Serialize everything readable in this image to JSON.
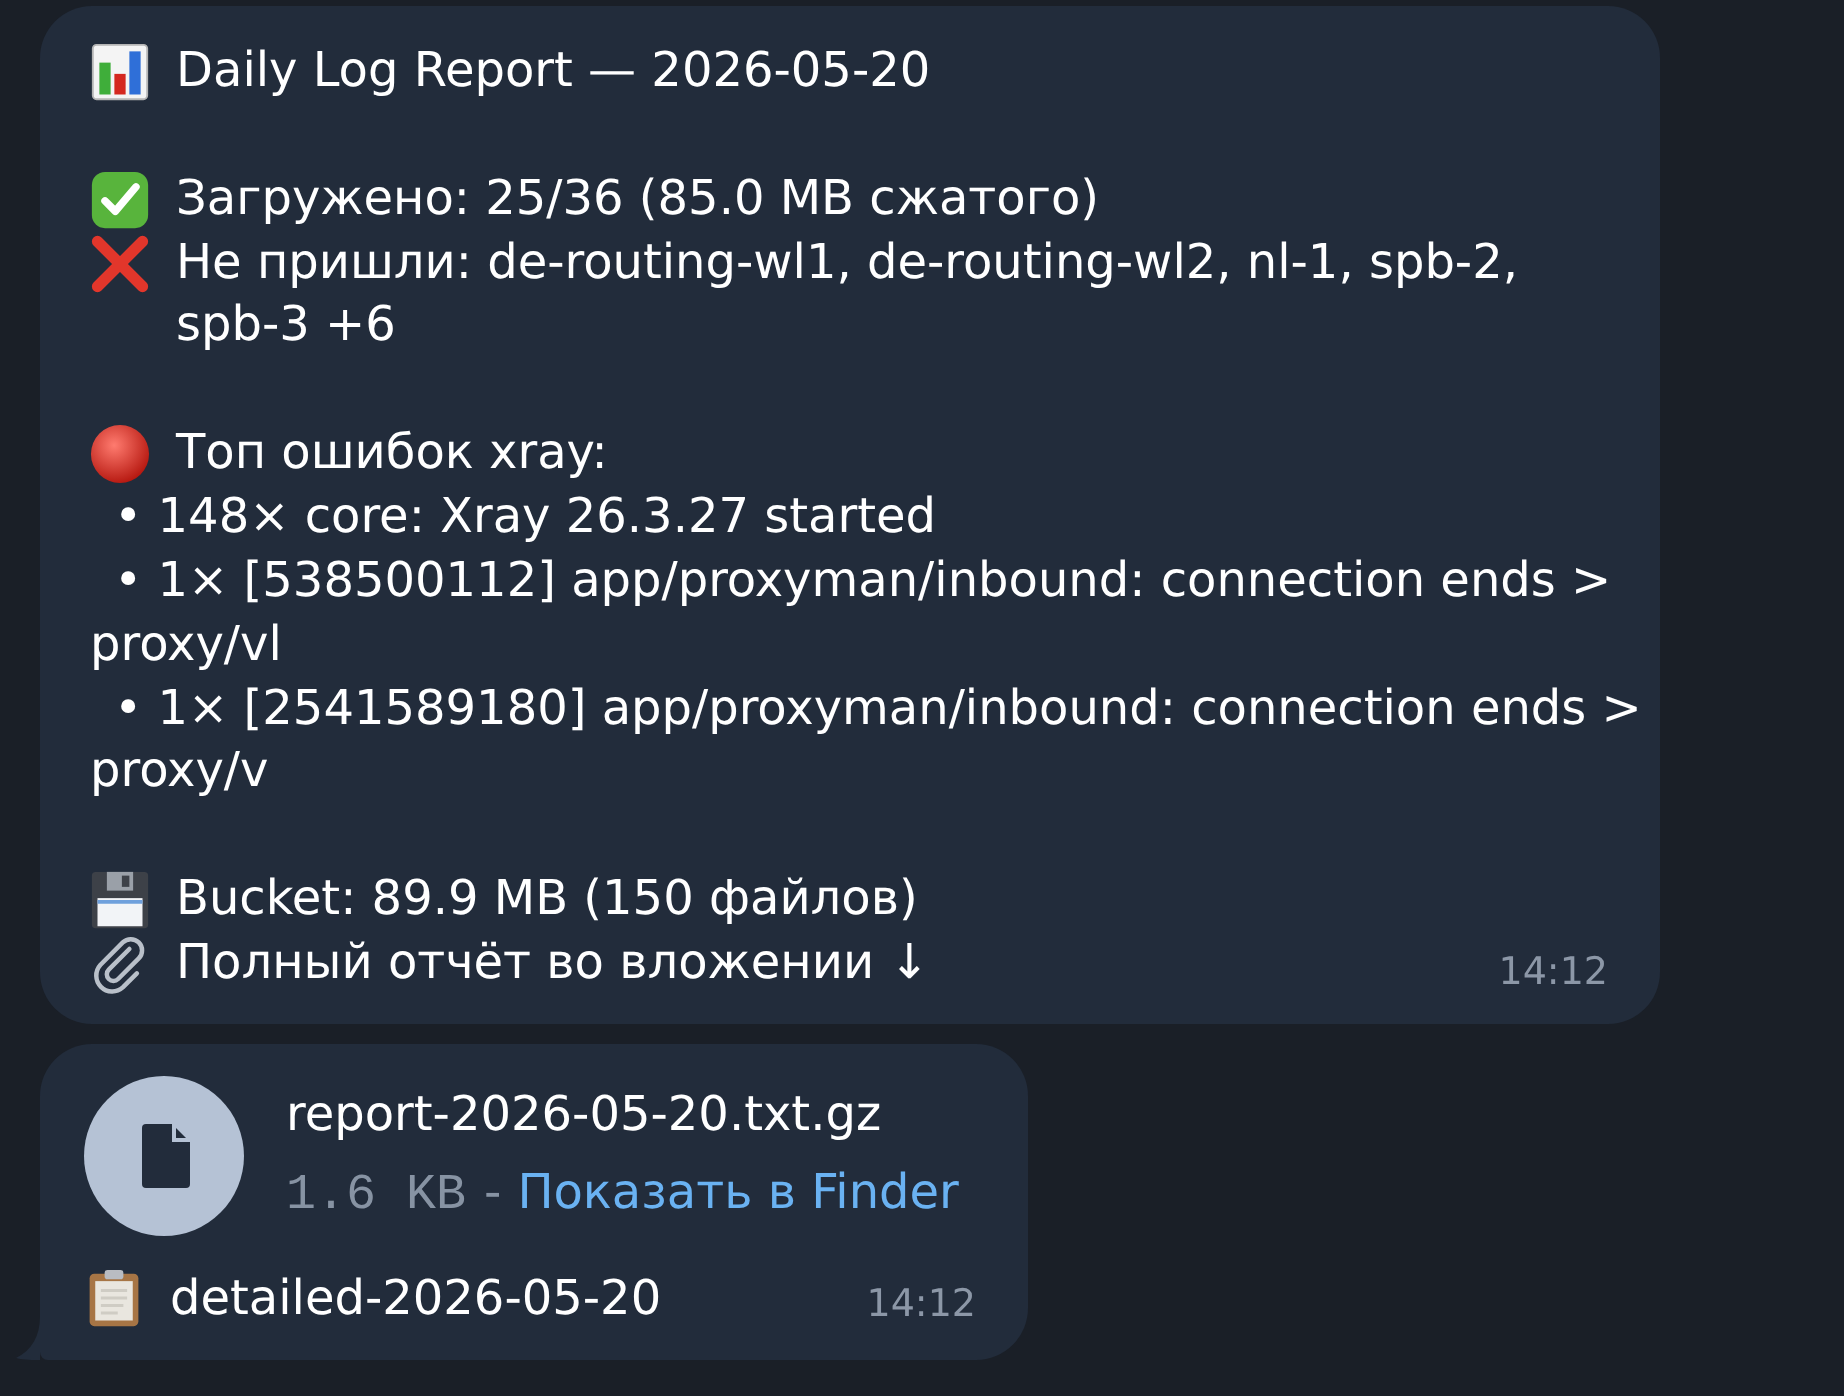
{
  "messages": [
    {
      "kind": "text",
      "sections": [
        {
          "lines": [
            {
              "kind": "heading",
              "text": "Daily Log Report — 2026-05-20"
            }
          ]
        },
        {
          "lines": [
            {
              "kind": "success",
              "text": "Загружено: 25/36 (85.0 MB сжатого)"
            },
            {
              "kind": "failure",
              "text": "Не пришли: de-routing-wl1, de-routing-wl2, nl-1, spb-2, spb-3 +6"
            }
          ]
        },
        {
          "lines": [
            {
              "kind": "alert",
              "text": "Топ ошибок xray:"
            },
            {
              "kind": "bullet",
              "text": "• 148× core: Xray 26.3.27 started"
            },
            {
              "kind": "bullet",
              "text": "• 1× [538500112] app/proxyman/inbound: connection ends > proxy/vl"
            },
            {
              "kind": "bullet",
              "text": "• 1× [2541589180] app/proxyman/inbound: connection ends > proxy/v"
            }
          ]
        },
        {
          "lines": [
            {
              "kind": "storage",
              "text": "Bucket: 89.9 MB (150 файлов)"
            },
            {
              "kind": "attachment",
              "text": "Полный отчёт во вложении ↓"
            }
          ]
        }
      ],
      "time": "14:12"
    },
    {
      "kind": "file",
      "file": {
        "name": "report-2026-05-20.txt.gz",
        "size": "1.6 KB",
        "separator": "-",
        "action": "Показать в Finder"
      },
      "caption": {
        "kind": "document",
        "text": "detailed-2026-05-20"
      },
      "time": "14:12"
    }
  ]
}
